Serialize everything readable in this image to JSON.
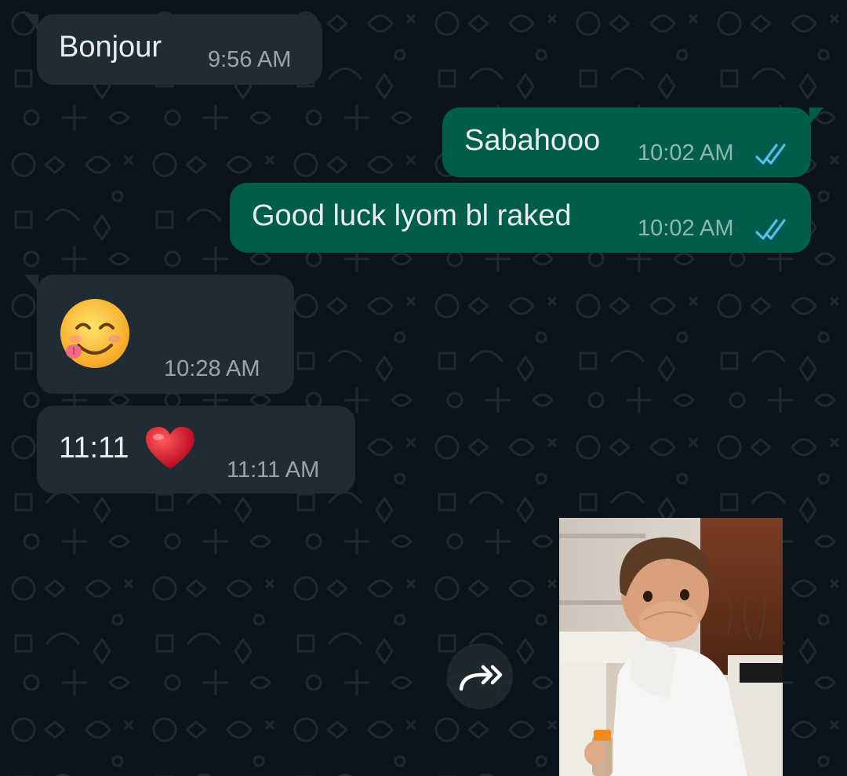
{
  "chat": {
    "messages": [
      {
        "direction": "incoming",
        "text": "Bonjour",
        "time": "9:56 AM"
      },
      {
        "direction": "outgoing",
        "text": "Sabahooo",
        "time": "10:02 AM",
        "status": "read"
      },
      {
        "direction": "outgoing",
        "text": "Good luck lyom bl raked",
        "time": "10:02 AM",
        "status": "read"
      },
      {
        "direction": "incoming",
        "emoji": "face-savoring-food-emoji",
        "time": "10:28 AM"
      },
      {
        "direction": "incoming",
        "text": "11:11",
        "emoji": "red-heart-emoji",
        "time": "11:11 AM"
      },
      {
        "direction": "incoming",
        "type": "image",
        "image_subject": "toddler-photo",
        "forward_icon": "forward-icon"
      }
    ]
  },
  "colors": {
    "background": "#0b141a",
    "incoming_bubble": "#202c33",
    "outgoing_bubble": "#005c4b",
    "read_ticks": "#53bdeb"
  }
}
